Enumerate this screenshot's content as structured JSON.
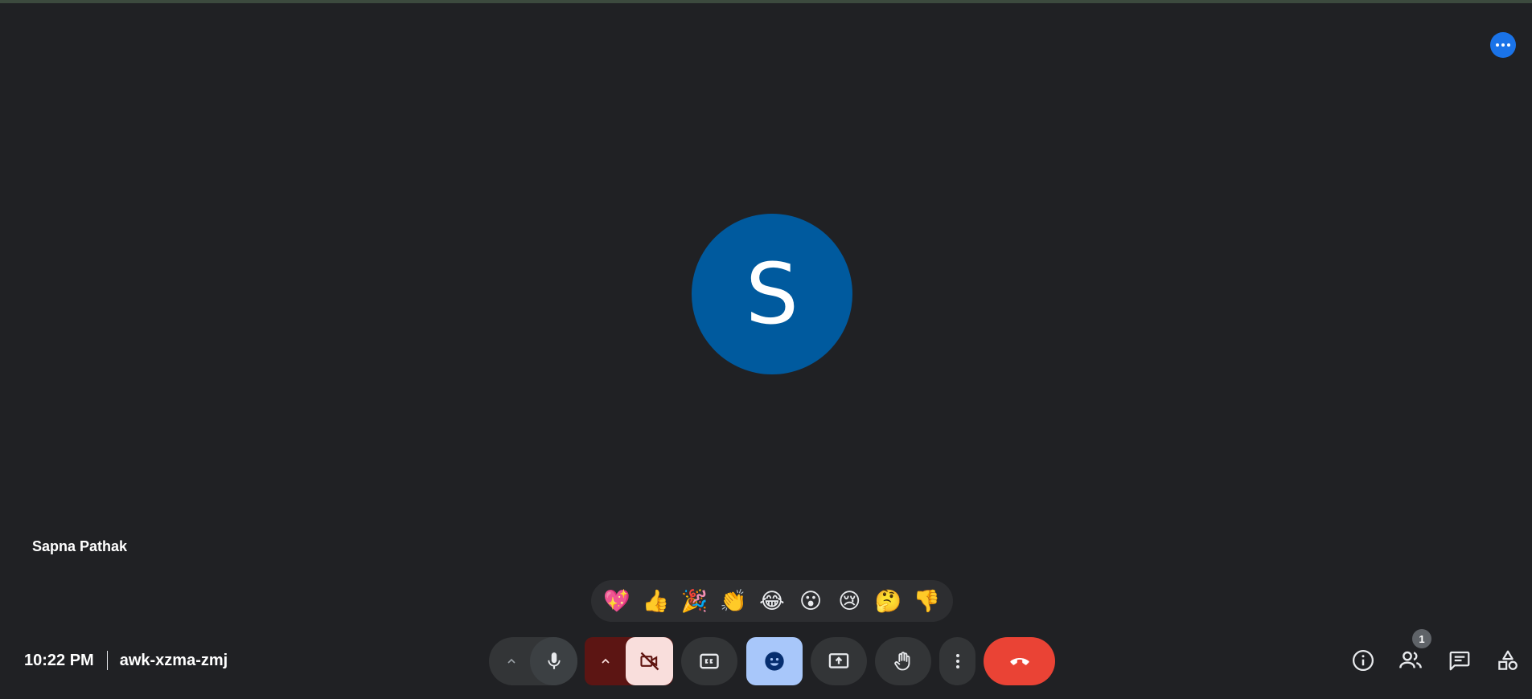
{
  "participant": {
    "name": "Sapna Pathak",
    "initial": "S",
    "avatar_color": "#005a9e"
  },
  "meeting": {
    "time": "10:22 PM",
    "code": "awk-xzma-zmj"
  },
  "reactions": [
    {
      "name": "sparkling-heart",
      "emoji": "💖"
    },
    {
      "name": "thumbs-up",
      "emoji": "👍"
    },
    {
      "name": "party-popper",
      "emoji": "🎉"
    },
    {
      "name": "clapping-hands",
      "emoji": "👏"
    },
    {
      "name": "tears-of-joy",
      "emoji": "😂"
    },
    {
      "name": "surprised",
      "emoji": "😮"
    },
    {
      "name": "crying",
      "emoji": "😢"
    },
    {
      "name": "thinking",
      "emoji": "🤔"
    },
    {
      "name": "thumbs-down",
      "emoji": "👎"
    }
  ],
  "controls": {
    "mic_options": "chevron-up-icon",
    "mic": "mic-icon",
    "camera_options": "chevron-up-icon",
    "camera": "videocam-off-icon",
    "captions": "closed-captions-icon",
    "reactions": "emoji-icon",
    "present": "present-screen-icon",
    "raise_hand": "raise-hand-icon",
    "more": "more-vert-icon",
    "leave": "call-end-icon"
  },
  "side_panel": {
    "info": "info-icon",
    "people": "people-icon",
    "people_count": "1",
    "chat": "chat-icon",
    "activities": "activities-icon"
  },
  "colors": {
    "background": "#202124",
    "accent_blue": "#1a73e8",
    "leave_red": "#ea4335",
    "camera_off_dark": "#5c1513",
    "camera_off_light": "#f9dedc",
    "reactions_active": "#a8c7fa"
  }
}
